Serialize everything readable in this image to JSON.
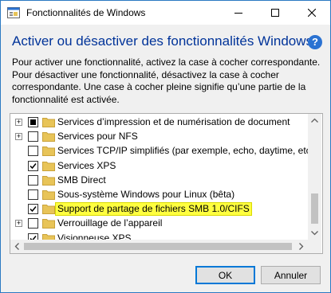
{
  "window": {
    "title": "Fonctionnalités de Windows",
    "controls": {
      "minimize": "—",
      "maximize": "☐",
      "close": "✕"
    }
  },
  "heading": "Activer ou désactiver des fonctionnalités Windows",
  "help": "?",
  "description": [
    "Pour activer une fonctionnalité, activez la case à cocher correspondante.",
    "Pour désactiver une fonctionnalité, désactivez la case à cocher correspondante. Une case à cocher pleine signifie qu’une partie de la fonctionnalité est activée."
  ],
  "features": [
    {
      "label": "Services d’impression et de numérisation de document",
      "state": "partial",
      "expandable": true
    },
    {
      "label": "Services pour NFS",
      "state": "unchecked",
      "expandable": true
    },
    {
      "label": "Services TCP/IP simplifiés (par exemple, echo, daytime, etc.)",
      "state": "unchecked",
      "expandable": false
    },
    {
      "label": "Services XPS",
      "state": "checked",
      "expandable": false
    },
    {
      "label": "SMB Direct",
      "state": "unchecked",
      "expandable": false
    },
    {
      "label": "Sous-système Windows pour Linux (bêta)",
      "state": "unchecked",
      "expandable": false
    },
    {
      "label": "Support de partage de fichiers SMB 1.0/CIFS",
      "state": "checked",
      "expandable": false,
      "highlighted": true
    },
    {
      "label": "Verrouillage de l’appareil",
      "state": "unchecked",
      "expandable": true
    },
    {
      "label": "Visionneuse XPS",
      "state": "checked",
      "expandable": false
    }
  ],
  "buttons": {
    "ok": "OK",
    "cancel": "Annuler"
  },
  "colors": {
    "heading": "#003399",
    "highlight": "#ffff40",
    "accent": "#0078d7",
    "folder": "#e8c458"
  }
}
